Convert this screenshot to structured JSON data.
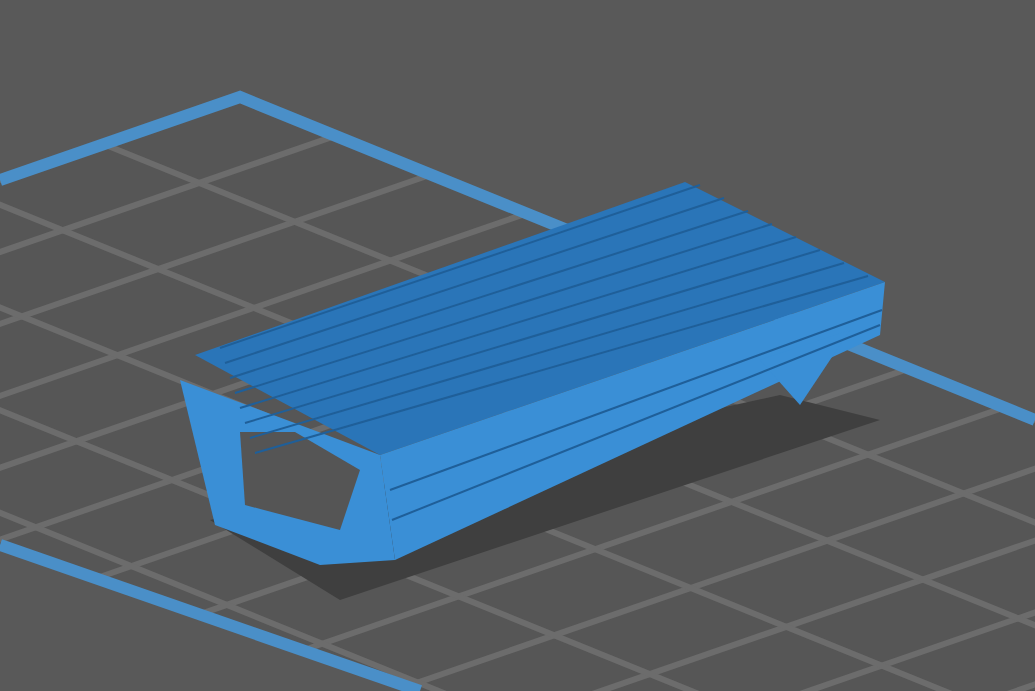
{
  "scene": {
    "objects": [
      {
        "kind": "plate"
      },
      {
        "kind": "model"
      }
    ]
  }
}
